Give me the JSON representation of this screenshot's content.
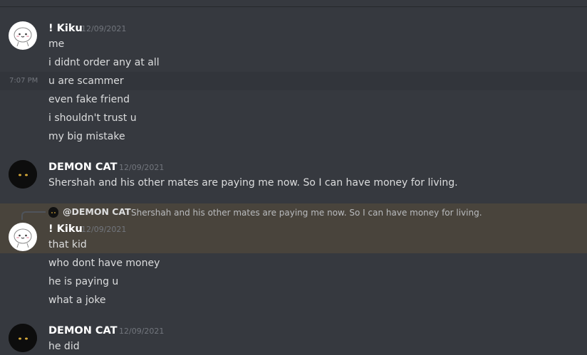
{
  "messages": {
    "g1": {
      "author": "! Kiku",
      "date": "12/09/2021",
      "hover_time": "7:07 PM",
      "lines": [
        "me",
        "i didnt order any at all",
        "u are scammer",
        "even fake friend",
        "i shouldn't trust u",
        "my big mistake"
      ]
    },
    "g2": {
      "author": "DEMON CAT",
      "date": "12/09/2021",
      "lines": [
        "Shershah and his other mates are paying me now. So I can have money for living."
      ]
    },
    "g3": {
      "reply_author": "@DEMON CAT",
      "reply_text": "Shershah and his other mates are paying me now. So I can have money for living.",
      "author": "! Kiku",
      "date": "12/09/2021",
      "lines": [
        "that kid",
        "who dont have money",
        "he is paying u",
        "what a joke"
      ]
    },
    "g4": {
      "author": "DEMON CAT",
      "date": "12/09/2021",
      "lines": [
        "he did"
      ]
    }
  },
  "colors": {
    "background": "#36393f",
    "mention_highlight": "#49443c",
    "username": "#ffffff",
    "text": "#dcddde",
    "timestamp": "#72767d"
  }
}
